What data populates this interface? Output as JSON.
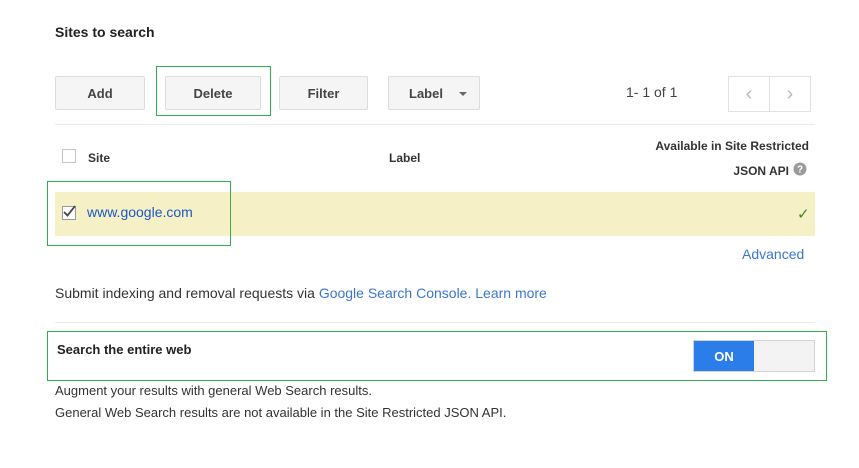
{
  "section_title": "Sites to search",
  "toolbar": {
    "add_label": "Add",
    "delete_label": "Delete",
    "filter_label": "Filter",
    "label_label": "Label"
  },
  "pager": {
    "text": "1- 1 of 1",
    "prev_icon": "‹",
    "next_icon": "›"
  },
  "table": {
    "col_site": "Site",
    "col_label": "Label",
    "col_available_line1": "Available in Site Restricted",
    "col_available_line2": "JSON API",
    "rows": [
      {
        "site": "www.google.com",
        "label": "",
        "checked": true,
        "available": "✓"
      }
    ]
  },
  "advanced_label": "Advanced",
  "submit": {
    "prefix": "Submit indexing and removal requests via ",
    "console_link": "Google Search Console.",
    "learn_more": "Learn more"
  },
  "entire_web": {
    "title": "Search the entire web",
    "toggle_on_label": "ON",
    "enabled": true,
    "desc1": "Augment your results with general Web Search results.",
    "desc2": "General Web Search results are not available in the Site Restricted JSON API."
  },
  "colors": {
    "highlight": "#2fae4a",
    "link": "#3b76cf",
    "selected_row": "#f5f0c6",
    "toggle_on": "#2b7de9"
  }
}
